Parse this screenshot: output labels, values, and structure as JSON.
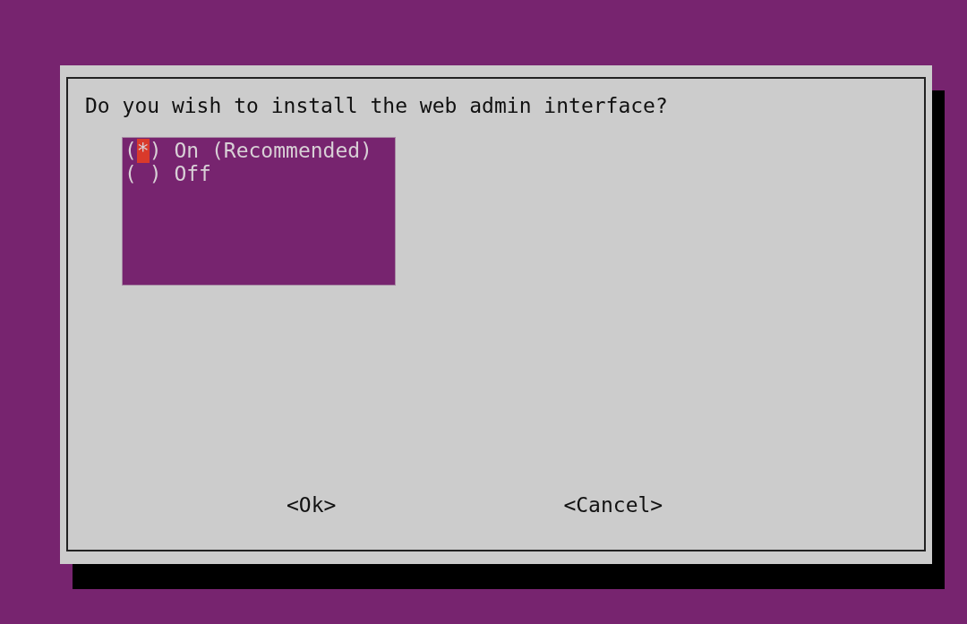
{
  "dialog": {
    "question": "Do you wish to install the web admin interface?",
    "options": [
      {
        "marker": "(*)",
        "label": "On (Recommended)",
        "selected": true
      },
      {
        "marker": "( )",
        "label": "Off",
        "selected": false
      }
    ],
    "buttons": [
      "<Ok>",
      "<Cancel>"
    ]
  }
}
